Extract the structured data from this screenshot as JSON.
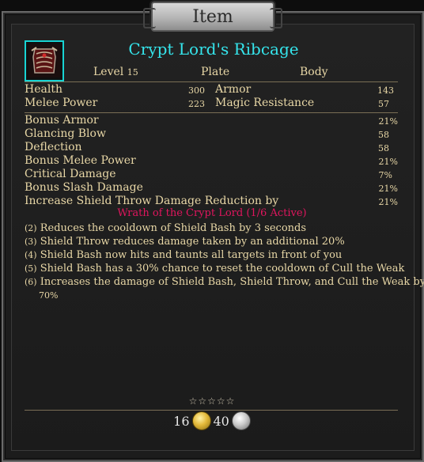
{
  "window_title": "Item",
  "item": {
    "name": "Crypt Lord's Ribcage",
    "icon": "armor-ribcage-icon",
    "level_label": "Level",
    "level_value": "15",
    "type": "Plate",
    "slot": "Body"
  },
  "main_stats": {
    "left": [
      {
        "label": "Health",
        "value": "300"
      },
      {
        "label": "Melee Power",
        "value": "223"
      }
    ],
    "right": [
      {
        "label": "Armor",
        "value": "143"
      },
      {
        "label": "Magic Resistance",
        "value": "57"
      }
    ]
  },
  "secondary_stats": [
    {
      "label": "Bonus Armor",
      "value": "21%"
    },
    {
      "label": "Glancing Blow",
      "value": "58"
    },
    {
      "label": "Deflection",
      "value": "58"
    },
    {
      "label": "Bonus Melee Power",
      "value": "21%"
    },
    {
      "label": "Critical Damage",
      "value": "7%"
    },
    {
      "label": "Bonus Slash Damage",
      "value": "21%"
    },
    {
      "label": "Increase Shield Throw Damage Reduction by",
      "value": "21%"
    }
  ],
  "set": {
    "name": "Wrath of the Crypt Lord (1/6 Active)",
    "bonuses": [
      {
        "req": "(2)",
        "text": "Reduces the cooldown of Shield Bash by 3 seconds"
      },
      {
        "req": "(3)",
        "text": "Shield Throw reduces damage taken by an additional 20%"
      },
      {
        "req": "(4)",
        "text": "Shield Bash now hits and taunts all targets in front of you"
      },
      {
        "req": "(5)",
        "text": "Shield Bash has a 30% chance to reset the cooldown of Cull the Weak"
      },
      {
        "req": "(6)",
        "text": "Increases the damage of Shield Bash, Shield Throw, and Cull the Weak by",
        "text2": "70%"
      }
    ]
  },
  "rating": {
    "stars": "☆☆☆☆☆",
    "filled": 0,
    "max": 5
  },
  "price": {
    "gold": "16",
    "silver": "40"
  },
  "colors": {
    "item_name": "#35e5ec",
    "set_name": "#e0165e",
    "text": "#e8d7a6"
  }
}
